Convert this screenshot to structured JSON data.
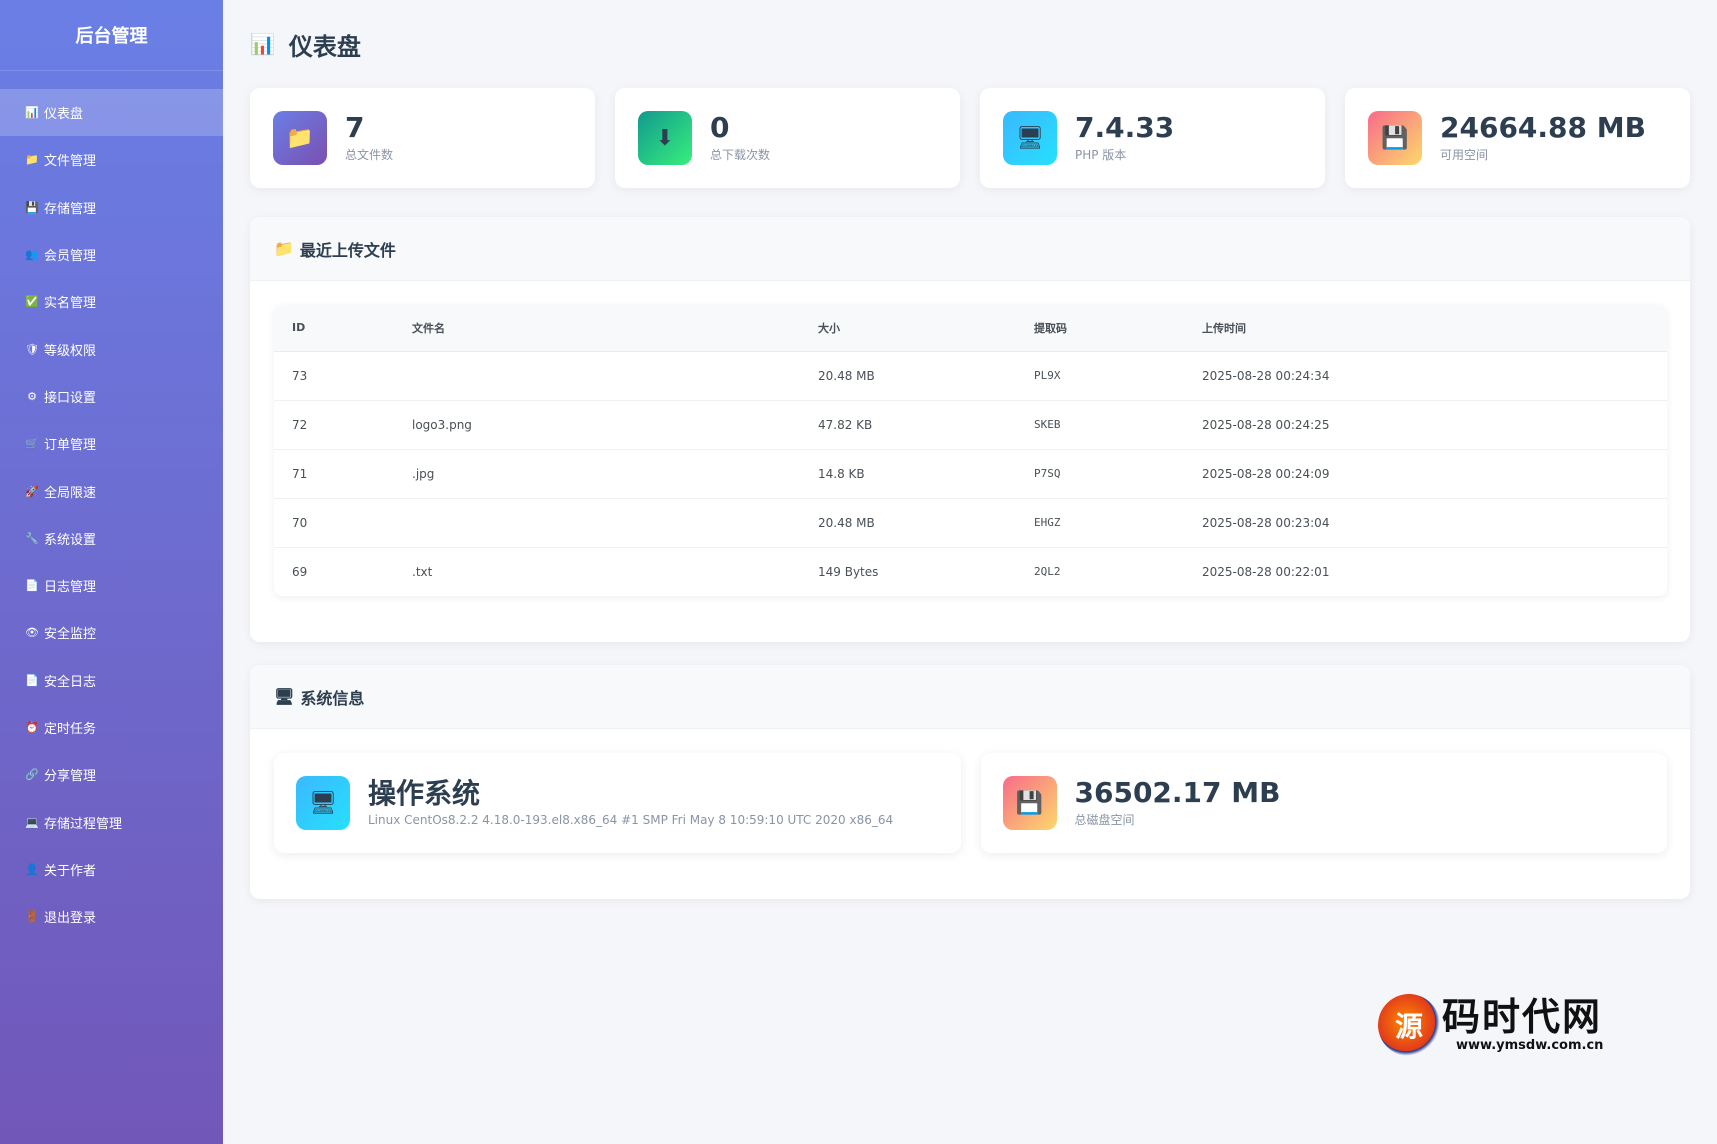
{
  "sidebar": {
    "brand": "后台管理",
    "items": [
      {
        "icon": "📊",
        "label": "仪表盘",
        "active": true
      },
      {
        "icon": "📁",
        "label": "文件管理"
      },
      {
        "icon": "💾",
        "label": "存储管理"
      },
      {
        "icon": "👥",
        "label": "会员管理"
      },
      {
        "icon": "✅",
        "label": "实名管理"
      },
      {
        "icon": "🛡",
        "label": "等级权限"
      },
      {
        "icon": "⚙",
        "label": "接口设置"
      },
      {
        "icon": "🛒",
        "label": "订单管理"
      },
      {
        "icon": "🚀",
        "label": "全局限速"
      },
      {
        "icon": "🔧",
        "label": "系统设置"
      },
      {
        "icon": "📄",
        "label": "日志管理"
      },
      {
        "icon": "👁",
        "label": "安全监控"
      },
      {
        "icon": "📄",
        "label": "安全日志"
      },
      {
        "icon": "⏰",
        "label": "定时任务"
      },
      {
        "icon": "🔗",
        "label": "分享管理"
      },
      {
        "icon": "💻",
        "label": "存储过程管理"
      },
      {
        "icon": "👤",
        "label": "关于作者"
      },
      {
        "icon": "🚪",
        "label": "退出登录"
      }
    ]
  },
  "page": {
    "title": "仪表盘",
    "title_icon": "📊"
  },
  "stats": [
    {
      "icon": "📁",
      "value": "7",
      "label": "总文件数"
    },
    {
      "icon": "⬇",
      "value": "0",
      "label": "总下载次数"
    },
    {
      "icon": "🖥",
      "value": "7.4.33",
      "label": "PHP 版本"
    },
    {
      "icon": "💾",
      "value": "24664.88 MB",
      "label": "可用空间"
    }
  ],
  "recent": {
    "title": "最近上传文件",
    "icon": "📁",
    "columns": [
      "ID",
      "文件名",
      "大小",
      "提取码",
      "上传时间"
    ],
    "rows": [
      [
        "73",
        "",
        "20.48 MB",
        "PL9X",
        "2025-08-28 00:24:34"
      ],
      [
        "72",
        "logo3.png",
        "47.82 KB",
        "SKEB",
        "2025-08-28 00:24:25"
      ],
      [
        "71",
        ".jpg",
        "14.8 KB",
        "P7SQ",
        "2025-08-28 00:24:09"
      ],
      [
        "70",
        "",
        "20.48 MB",
        "EHGZ",
        "2025-08-28 00:23:04"
      ],
      [
        "69",
        ".txt",
        "149 Bytes",
        "2QL2",
        "2025-08-28 00:22:01"
      ]
    ]
  },
  "system": {
    "title": "系统信息",
    "icon": "🖥",
    "cards": [
      {
        "icon": "🖥",
        "value": "操作系统",
        "label": "Linux CentOs8.2.2 4.18.0-193.el8.x86_64 #1 SMP Fri May 8 10:59:10 UTC 2020 x86_64"
      },
      {
        "icon": "💾",
        "value": "36502.17 MB",
        "label": "总磁盘空间"
      }
    ]
  },
  "watermark": {
    "glyph": "源",
    "title": "码时代网",
    "url": "www.ymsdw.com.cn"
  }
}
